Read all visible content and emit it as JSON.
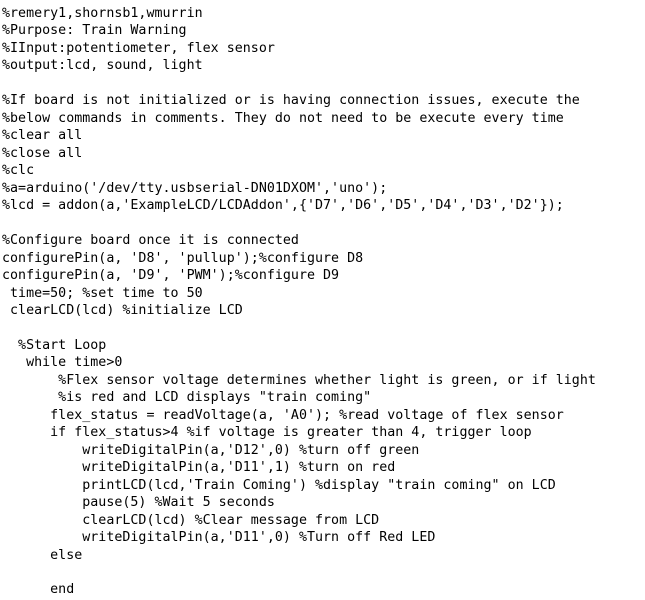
{
  "document": {
    "kind": "source-code-listing",
    "language": "MATLAB",
    "background_color": "#ffffff",
    "text_color": "#000000",
    "title_comment": "%remery1,shornsb1,wmurrin",
    "purpose": "Train Warning",
    "inputs": "potentiometer, flex sensor",
    "outputs": "lcd, sound, light"
  },
  "code": {
    "lines": [
      "%remery1,shornsb1,wmurrin",
      "%Purpose: Train Warning",
      "%IInput:potentiometer, flex sensor",
      "%output:lcd, sound, light",
      "",
      "%If board is not initialized or is having connection issues, execute the",
      "%below commands in comments. They do not need to be execute every time",
      "%clear all",
      "%close all",
      "%clc",
      "%a=arduino('/dev/tty.usbserial-DN01DXOM','uno');",
      "%lcd = addon(a,'ExampleLCD/LCDAddon',{'D7','D6','D5','D4','D3','D2'});",
      "",
      "%Configure board once it is connected",
      "configurePin(a, 'D8', 'pullup');%configure D8",
      "configurePin(a, 'D9', 'PWM');%configure D9",
      " time=50; %set time to 50",
      " clearLCD(lcd) %initialize LCD",
      "",
      "  %Start Loop",
      "   while time>0",
      "       %Flex sensor voltage determines whether light is green, or if light",
      "       %is red and LCD displays \"train coming\"",
      "      flex_status = readVoltage(a, 'A0'); %read voltage of flex sensor",
      "      if flex_status>4 %if voltage is greater than 4, trigger loop",
      "          writeDigitalPin(a,'D12',0) %turn off green",
      "          writeDigitalPin(a,'D11',1) %turn on red",
      "          printLCD(lcd,'Train Coming') %display \"train coming\" on LCD",
      "          pause(5) %Wait 5 seconds",
      "          clearLCD(lcd) %Clear message from LCD",
      "          writeDigitalPin(a,'D11',0) %Turn off Red LED",
      "      else",
      "",
      "      end"
    ]
  }
}
